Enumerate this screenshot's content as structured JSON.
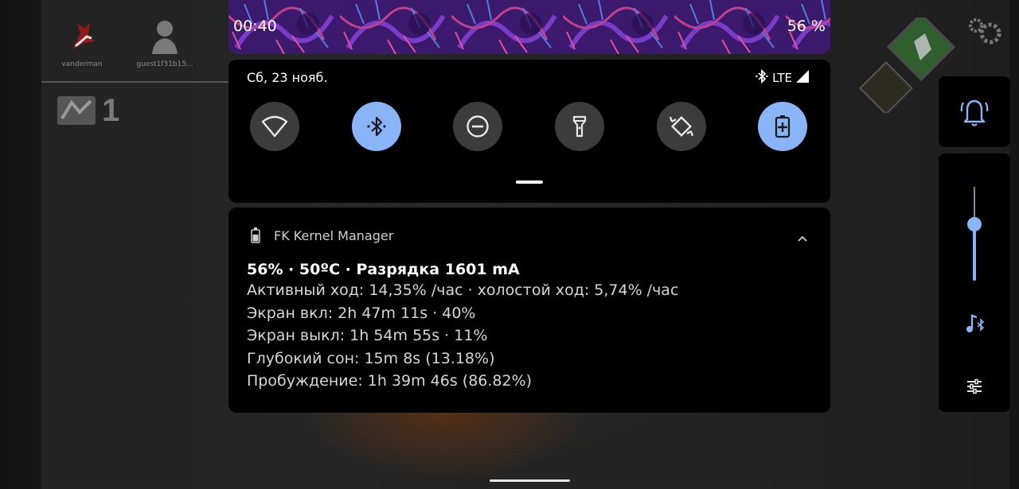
{
  "header": {
    "time": "00:40",
    "battery_percent": "56 %"
  },
  "quick_settings": {
    "date": "Сб, 23 нояб.",
    "network_type": "LTE",
    "tiles": [
      {
        "name": "wifi",
        "icon": "wifi-icon",
        "active": false
      },
      {
        "name": "bluetooth",
        "icon": "bluetooth-icon",
        "active": true
      },
      {
        "name": "do-not-disturb",
        "icon": "do-not-disturb-icon",
        "active": false
      },
      {
        "name": "flashlight",
        "icon": "flashlight-icon",
        "active": false
      },
      {
        "name": "auto-rotate",
        "icon": "auto-rotate-icon",
        "active": false
      },
      {
        "name": "battery-saver",
        "icon": "battery-saver-icon",
        "active": true
      }
    ]
  },
  "notification": {
    "app_name": "FK Kernel Manager",
    "title": "56% · 50ºC · Разрядка 1601 mA",
    "lines": [
      "Активный ход: 14,35% /час · холостой ход: 5,74% /час",
      "Экран вкл: 2h 47m 11s  · 40%",
      "Экран выкл: 1h 54m 55s  · 11%",
      "Глубокий сон: 15m 8s  (13.18%)",
      "Пробуждение: 1h 39m 46s  (86.82%)"
    ]
  },
  "volume": {
    "level": 0.6,
    "ringer_icon": "bell-ringing-icon",
    "stream_icon": "music-bluetooth-icon",
    "settings_icon": "sliders-icon"
  },
  "background_game": {
    "players": [
      "vanderman",
      "guest1f31b15..."
    ],
    "item_count": "1"
  },
  "colors": {
    "accent": "#8ab4f8",
    "panel": "#000000",
    "tile_inactive": "#3c3c3c"
  }
}
